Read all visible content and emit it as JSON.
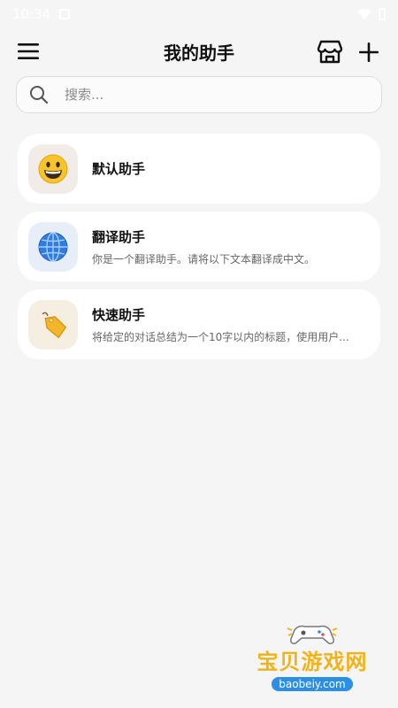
{
  "status_bar": {
    "time": "10:34"
  },
  "header": {
    "title": "我的助手",
    "menu_icon": "menu-icon",
    "store_icon": "store-icon",
    "add_icon": "plus-icon"
  },
  "search": {
    "placeholder": "搜索..."
  },
  "assistants": [
    {
      "name": "默认助手",
      "description": "",
      "icon": "grinning-face-emoji",
      "avatar_bg": "#f1ece8"
    },
    {
      "name": "翻译助手",
      "description": "你是一个翻译助手。请将以下文本翻译成中文。",
      "icon": "globe-emoji",
      "avatar_bg": "#e8eef8"
    },
    {
      "name": "快速助手",
      "description": "将给定的对话总结为一个10字以内的标题，使用用户...",
      "icon": "tag-emoji",
      "avatar_bg": "#f5efe2"
    }
  ],
  "watermark": {
    "title": "宝贝游戏网",
    "subtitle": "baobeiy.com"
  },
  "colors": {
    "background": "#f5f5f5",
    "card": "#ffffff",
    "watermark_yellow": "#f2b21b",
    "watermark_blue": "#2c8fe6"
  }
}
